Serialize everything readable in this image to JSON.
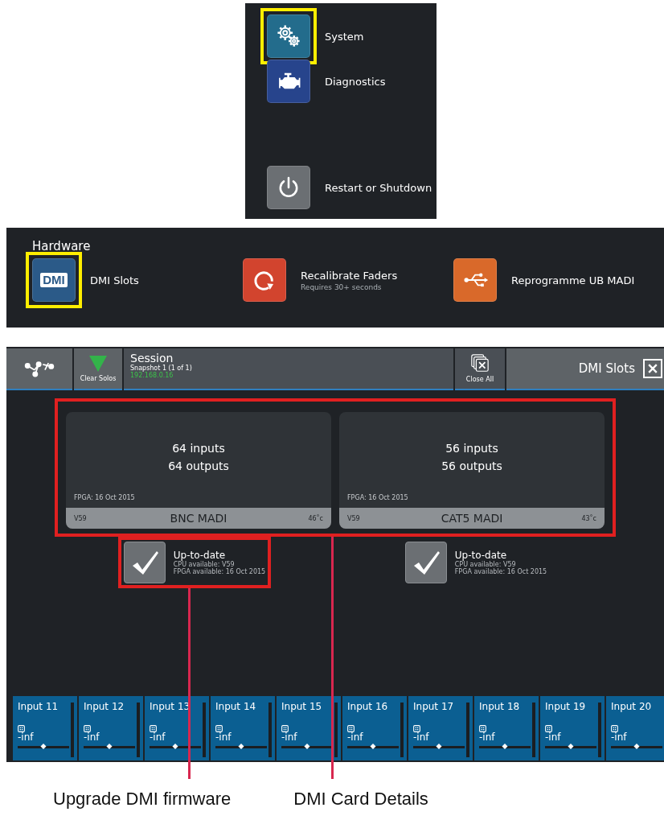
{
  "system_menu": {
    "items": [
      {
        "kind": "system",
        "label": "System",
        "highlighted": true
      },
      {
        "kind": "diagnostics",
        "label": "Diagnostics",
        "highlighted": false
      },
      {
        "kind": "power",
        "label": "Restart or Shutdown",
        "highlighted": false
      }
    ]
  },
  "hardware_menu": {
    "title": "Hardware",
    "items": [
      {
        "kind": "dmi",
        "icon_text": "DMI",
        "label": "DMI Slots",
        "highlighted": true
      },
      {
        "kind": "recalibrate",
        "label": "Recalibrate Faders",
        "sublabel": "Requires 30+ seconds",
        "highlighted": false
      },
      {
        "kind": "usb",
        "label": "Reprogramme UB MADI",
        "highlighted": false
      }
    ]
  },
  "dmi_screen": {
    "toolbar": {
      "clear_solos": "Clear Solos",
      "session_title": "Session",
      "snapshot": "Snapshot 1 (1 of 1)",
      "ip": "192.168.0.16",
      "close_all": "Close All",
      "page_title": "DMI Slots"
    },
    "cards_highlighted": true,
    "cards": [
      {
        "inputs": "64 inputs",
        "outputs": "64 outputs",
        "fpga": "FPGA: 16 Oct 2015",
        "version": "V59",
        "name": "BNC MADI",
        "temperature": "46˚c",
        "status": "Up-to-date",
        "cpu_available": "CPU available: V59",
        "fpga_available": "FPGA available: 16 Oct 2015",
        "up_to_date": true,
        "status_highlighted": true
      },
      {
        "inputs": "56 inputs",
        "outputs": "56 outputs",
        "fpga": "FPGA: 16 Oct 2015",
        "version": "V59",
        "name": "CAT5 MADI",
        "temperature": "43˚c",
        "status": "Up-to-date",
        "cpu_available": "CPU available: V59",
        "fpga_available": "FPGA available: 16 Oct 2015",
        "up_to_date": true,
        "status_highlighted": false
      }
    ],
    "channels": [
      {
        "name": "Input 11",
        "value": "-inf",
        "level": 0.5
      },
      {
        "name": "Input 12",
        "value": "-inf",
        "level": 0.5
      },
      {
        "name": "Input 13",
        "value": "-inf",
        "level": 0.5
      },
      {
        "name": "Input 14",
        "value": "-inf",
        "level": 0.5
      },
      {
        "name": "Input 15",
        "value": "-inf",
        "level": 0.5
      },
      {
        "name": "Input 16",
        "value": "-inf",
        "level": 0.5
      },
      {
        "name": "Input 17",
        "value": "-inf",
        "level": 0.5
      },
      {
        "name": "Input 18",
        "value": "-inf",
        "level": 0.5
      },
      {
        "name": "Input 19",
        "value": "-inf",
        "level": 0.5
      },
      {
        "name": "Input 20",
        "value": "-inf",
        "level": 0.5
      }
    ]
  },
  "callouts": [
    {
      "label": "Upgrade DMI firmware"
    },
    {
      "label": "DMI Card Details"
    }
  ]
}
